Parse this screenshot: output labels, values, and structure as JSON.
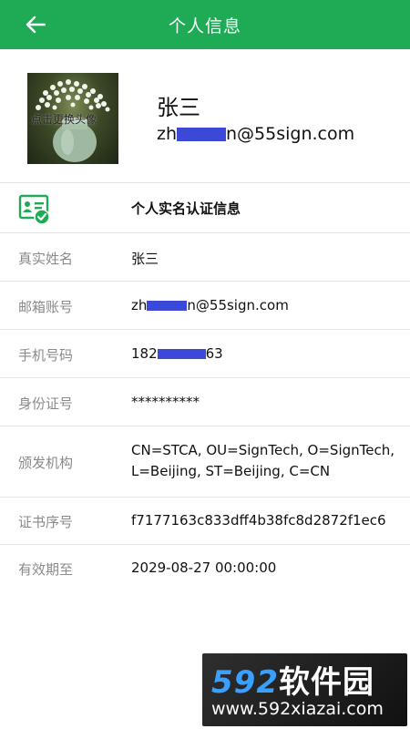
{
  "header": {
    "title": "个人信息",
    "back_icon": "arrow-left-icon",
    "background": "#1faa55"
  },
  "profile": {
    "avatar_caption": "点击更换头像",
    "name": "张三",
    "email_prefix": "zh",
    "email_suffix": "n@55sign.com"
  },
  "section": {
    "icon": "certificate-check-icon",
    "title": "个人实名认证信息"
  },
  "fields": {
    "real_name": {
      "label": "真实姓名",
      "value": "张三"
    },
    "email": {
      "label": "邮箱账号",
      "value_prefix": "zh",
      "value_suffix": "n@55sign.com"
    },
    "phone": {
      "label": "手机号码",
      "value_prefix": "182",
      "value_suffix": "63"
    },
    "id_number": {
      "label": "身份证号",
      "value": "**********"
    },
    "issuer": {
      "label": "颁发机构",
      "value": "CN=STCA, OU=SignTech, O=SignTech, L=Beijing, ST=Beijing, C=CN"
    },
    "serial": {
      "label": "证书序号",
      "value": "f7177163c833dff4b38fc8d2872f1ec6"
    },
    "expiry": {
      "label": "有效期至",
      "value": "2029-08-27 00:00:00"
    }
  },
  "watermark": {
    "digits": "592",
    "brand": "软件园",
    "url": "www.592xiazai.com"
  },
  "colors": {
    "accent": "#1faa55",
    "redaction": "#3b48d8"
  }
}
